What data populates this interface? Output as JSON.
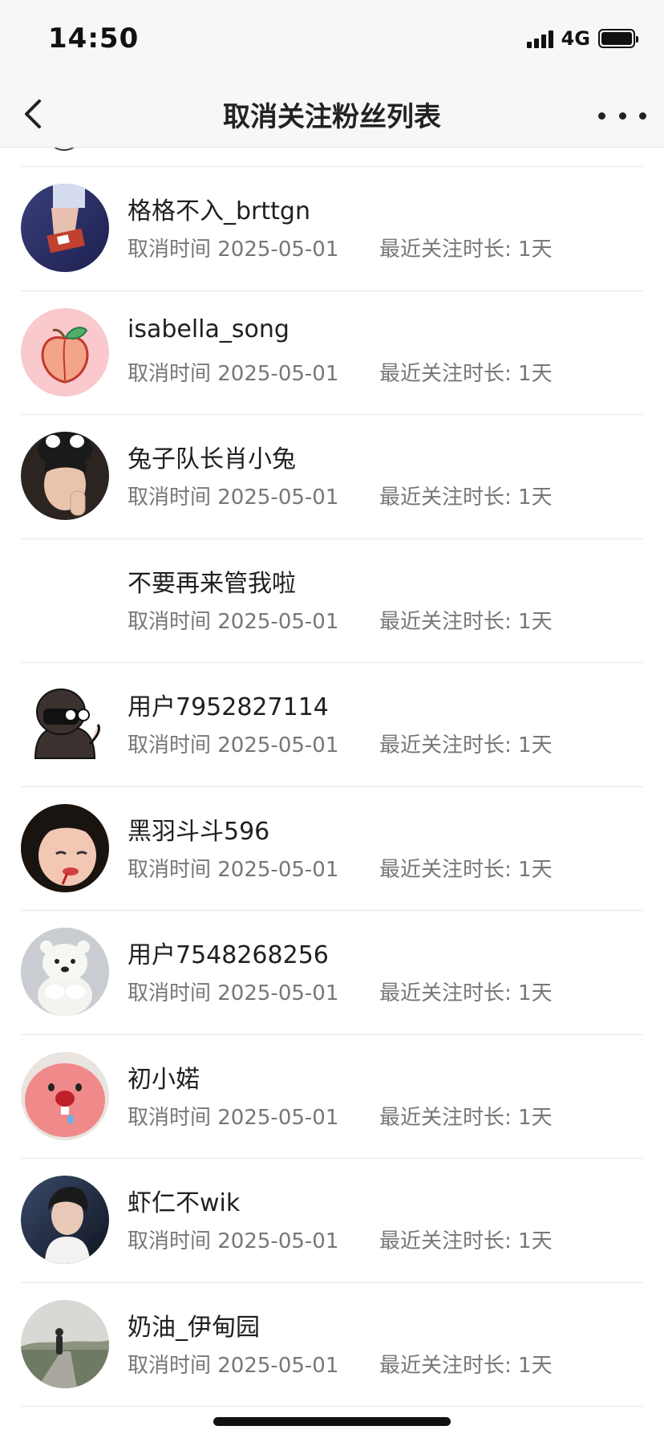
{
  "status_bar": {
    "time": "14:50",
    "network": "4G"
  },
  "navbar": {
    "title": "取消关注粉丝列表"
  },
  "rows": [
    {
      "name": "格格不入_brttgn",
      "cancel_time": "取消时间 2025-05-01",
      "duration": "最近关注时长: 1天",
      "avatar": "hands-photo-avatar"
    },
    {
      "name": "isabella_song",
      "cancel_time": "取消时间 2025-05-01",
      "duration": "最近关注时长: 1天",
      "avatar": "peach-avatar"
    },
    {
      "name": "兔子队长肖小兔",
      "cancel_time": "取消时间 2025-05-01",
      "duration": "最近关注时长: 1天",
      "avatar": "person-photo-avatar"
    },
    {
      "name": "不要再来管我啦",
      "cancel_time": "取消时间 2025-05-01",
      "duration": "最近关注时长: 1天",
      "avatar": "blank-avatar"
    },
    {
      "name": "用户7952827114",
      "cancel_time": "取消时间 2025-05-01",
      "duration": "最近关注时长: 1天",
      "avatar": "cartoon-hooded-avatar"
    },
    {
      "name": "黑羽斗斗596",
      "cancel_time": "取消时间 2025-05-01",
      "duration": "最近关注时长: 1天",
      "avatar": "person-photo-avatar"
    },
    {
      "name": "用户7548268256",
      "cancel_time": "取消时间 2025-05-01",
      "duration": "最近关注时长: 1天",
      "avatar": "polar-bear-avatar"
    },
    {
      "name": "初小婼",
      "cancel_time": "取消时间 2025-05-01",
      "duration": "最近关注时长: 1天",
      "avatar": "pink-plush-avatar"
    },
    {
      "name": "虾仁不wik",
      "cancel_time": "取消时间 2025-05-01",
      "duration": "最近关注时长: 1天",
      "avatar": "person-photo-avatar"
    },
    {
      "name": "奶油_伊甸园",
      "cancel_time": "取消时间 2025-05-01",
      "duration": "最近关注时长: 1天",
      "avatar": "landscape-photo-avatar"
    }
  ]
}
